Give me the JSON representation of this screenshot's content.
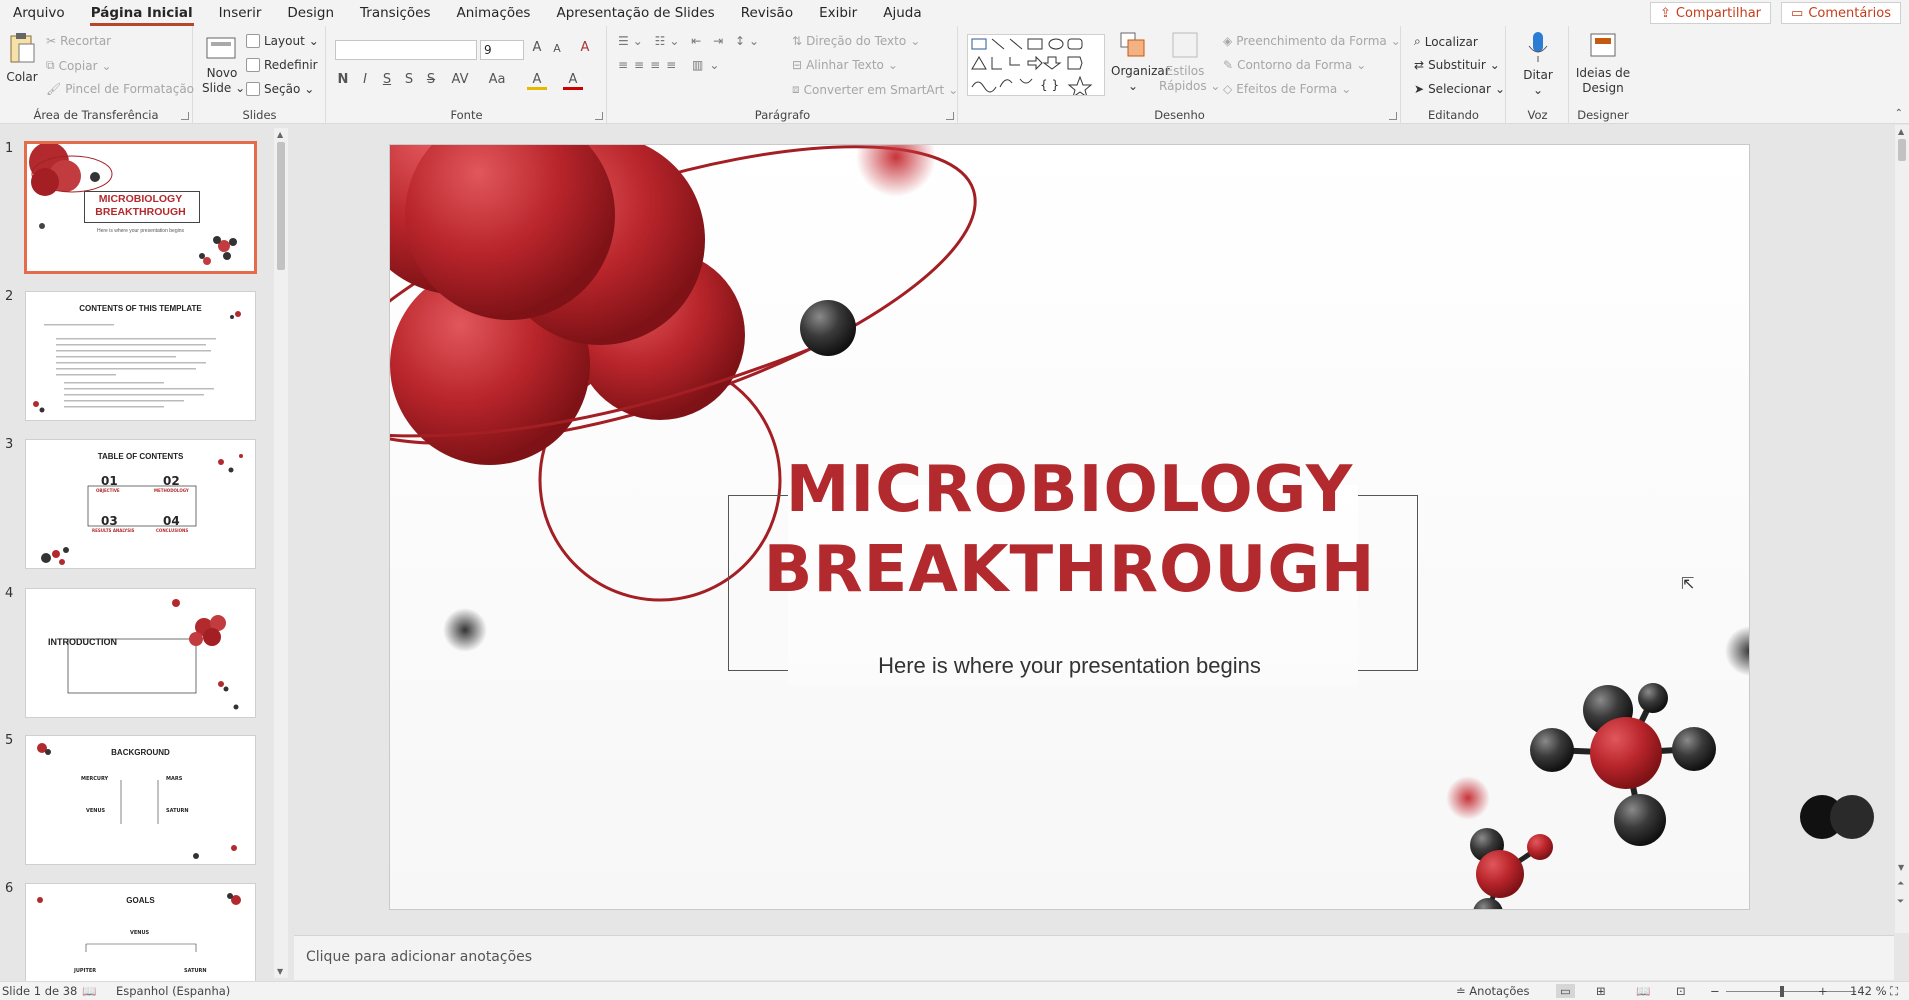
{
  "menubar": {
    "tabs": [
      "Arquivo",
      "Página Inicial",
      "Inserir",
      "Design",
      "Transições",
      "Animações",
      "Apresentação de Slides",
      "Revisão",
      "Exibir",
      "Ajuda"
    ],
    "share_label": "Compartilhar",
    "comments_label": "Comentários"
  },
  "ribbon": {
    "clipboard": {
      "paste": "Colar",
      "cut": "Recortar",
      "copy": "Copiar",
      "format_painter": "Pincel de Formatação",
      "label": "Área de Transferência"
    },
    "slides": {
      "new_slide": "Novo Slide",
      "layout": "Layout",
      "reset": "Redefinir",
      "section": "Seção",
      "label": "Slides"
    },
    "font": {
      "font_name": "",
      "font_size": "9",
      "bold": "N",
      "italic": "I",
      "underline": "S",
      "strike": "S",
      "spacing": "AV",
      "case": "Aa",
      "highlight": "A",
      "color": "A",
      "grow": "A",
      "shrink": "A",
      "clear": "A",
      "label": "Fonte"
    },
    "paragraph": {
      "text_direction": "Direção do Texto",
      "align_text": "Alinhar Texto",
      "smartart": "Converter em SmartArt",
      "label": "Parágrafo"
    },
    "drawing": {
      "arrange": "Organizar",
      "quick_styles": "Estilos Rápidos",
      "fill": "Preenchimento da Forma",
      "outline": "Contorno da Forma",
      "effects": "Efeitos de Forma",
      "label": "Desenho"
    },
    "editing": {
      "find": "Localizar",
      "replace": "Substituir",
      "select": "Selecionar",
      "label": "Editando"
    },
    "voice": {
      "dictate": "Ditar",
      "label": "Voz"
    },
    "designer": {
      "ideas": "Ideias de Design",
      "label": "Designer"
    }
  },
  "thumbnails": [
    {
      "num": "1",
      "title": "MICROBIOLOGY BREAKTHROUGH",
      "subtitle": "Here is where your presentation begins"
    },
    {
      "num": "2",
      "title": "CONTENTS OF THIS TEMPLATE"
    },
    {
      "num": "3",
      "title": "TABLE OF CONTENTS",
      "items": [
        "01",
        "02",
        "03",
        "04"
      ],
      "item_labels": [
        "OBJECTIVE",
        "METHODOLOGY",
        "RESULTS ANALYSIS",
        "CONCLUSIONS"
      ]
    },
    {
      "num": "4",
      "title": "INTRODUCTION"
    },
    {
      "num": "5",
      "title": "BACKGROUND",
      "items": [
        "MERCURY",
        "MARS",
        "VENUS",
        "SATURN"
      ]
    },
    {
      "num": "6",
      "title": "GOALS",
      "items": [
        "VENUS",
        "JUPITER",
        "SATURN"
      ]
    }
  ],
  "slide": {
    "title_line1": "MICROBIOLOGY",
    "title_line2": "BREAKTHROUGH",
    "subtitle": "Here is where your presentation begins",
    "accent_color": "#b22a2e"
  },
  "notes": {
    "placeholder": "Clique para adicionar anotações"
  },
  "status": {
    "slide_info": "Slide 1 de 38",
    "language": "Espanhol (Espanha)",
    "notes_label": "Anotações",
    "zoom": "142 %"
  }
}
